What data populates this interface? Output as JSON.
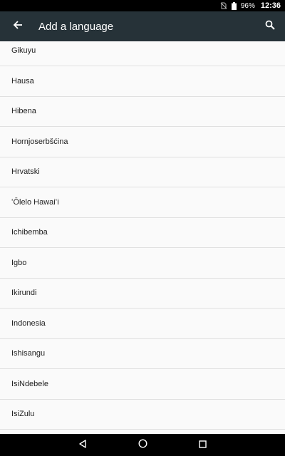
{
  "status_bar": {
    "battery": "96%",
    "time": "12:36"
  },
  "app_bar": {
    "title": "Add a language"
  },
  "languages": [
    "Gikuyu",
    "Hausa",
    "Hibena",
    "Hornjoserbšćina",
    "Hrvatski",
    "ʻŌlelo Hawaiʻi",
    "Ichibemba",
    "Igbo",
    "Ikirundi",
    "Indonesia",
    "Ishisangu",
    "IsiNdebele",
    "IsiZulu"
  ],
  "colors": {
    "app_bar": "#263238",
    "status_bar": "#000000",
    "nav_bar": "#000000",
    "list_background": "#fafafa",
    "divider": "#e0e0e0"
  }
}
